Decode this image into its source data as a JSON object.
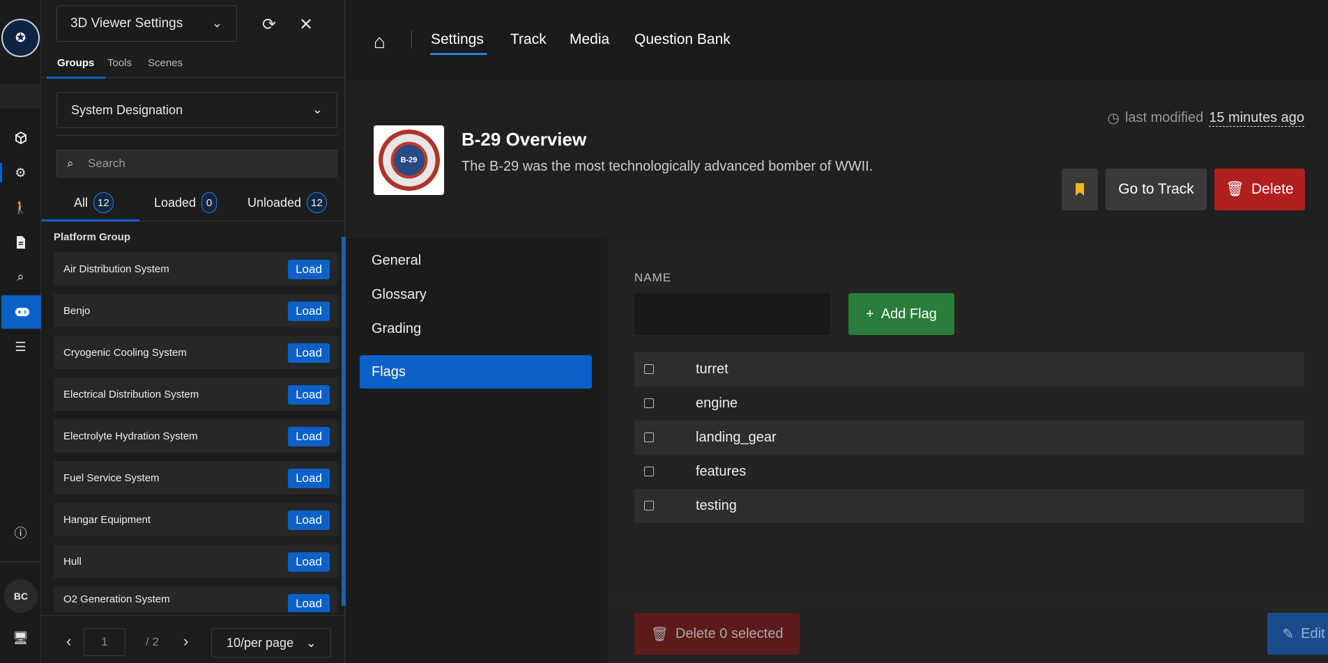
{
  "rail": {
    "avatar_initials": "BC",
    "items": [
      "cube-icon",
      "gear-icon",
      "walk-icon",
      "document-icon",
      "search-icon",
      "gamepad-icon",
      "list-icon"
    ]
  },
  "panel": {
    "viewer_select": "3D Viewer Settings",
    "tabs": [
      "Groups",
      "Tools",
      "Scenes"
    ],
    "group_select": "System Designation",
    "search_placeholder": "Search",
    "filters": [
      {
        "label": "All",
        "count": "12"
      },
      {
        "label": "Loaded",
        "count": "0"
      },
      {
        "label": "Unloaded",
        "count": "12"
      }
    ],
    "group_title": "Platform Group",
    "load_label": "Load",
    "items": [
      "Air Distribution System",
      "Benjo",
      "Cryogenic Cooling System",
      "Electrical Distribution System",
      "Electrolyte Hydration System",
      "Fuel Service System",
      "Hangar Equipment",
      "Hull",
      "O2 Generation System"
    ],
    "pagination": {
      "page": "1",
      "total": "/ 2",
      "per_page": "10/per page"
    }
  },
  "nav": {
    "links": [
      "Settings",
      "Track",
      "Media",
      "Question Bank"
    ]
  },
  "header": {
    "title": "B-29 Overview",
    "description": "The B-29 was the most technologically advanced bomber of WWII.",
    "last_modified_label": "last modified",
    "last_modified_value": "15 minutes ago",
    "go_to_track": "Go to Track",
    "delete": "Delete",
    "patch_text": "B-29"
  },
  "subnav": [
    "General",
    "Glossary",
    "Grading",
    "Flags"
  ],
  "flags": {
    "name_label": "NAME",
    "add_label": "Add Flag",
    "items": [
      "turret",
      "engine",
      "landing_gear",
      "features",
      "testing"
    ],
    "delete_selected": "Delete 0 selected",
    "edit": "Edit"
  },
  "colors": {
    "accent": "#0b61c7",
    "danger": "#b01e1e",
    "success": "#2a7d3a",
    "bookmark": "#f0b429"
  }
}
